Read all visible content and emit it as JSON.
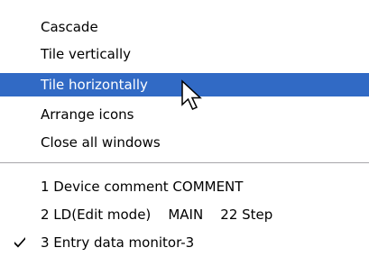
{
  "menu": {
    "arrange_items": [
      {
        "label": "Cascade"
      },
      {
        "label": "Tile vertically"
      },
      {
        "label": "Tile horizontally"
      },
      {
        "label": "Arrange icons"
      },
      {
        "label": "Close all windows"
      }
    ],
    "window_items": [
      {
        "label": "1 Device comment COMMENT",
        "checked": false
      },
      {
        "label": "2 LD(Edit mode)    MAIN    22 Step",
        "checked": false
      },
      {
        "label": "3 Entry data monitor-3",
        "checked": true
      }
    ],
    "highlighted_item": "Tile horizontally"
  },
  "colors": {
    "highlight": "#316ac5",
    "highlight_text": "#ffffff",
    "separator": "#a7a6aa"
  },
  "icons": {
    "checkmark": "check-icon",
    "pointer": "mouse-pointer-icon"
  }
}
